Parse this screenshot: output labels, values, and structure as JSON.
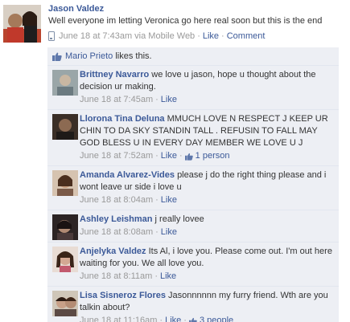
{
  "post": {
    "author": "Jason Valdez",
    "text": "Well everyone im letting Veronica go here real soon but this is the end",
    "timestamp": "June 18 at 7:43am via Mobile Web",
    "like_label": "Like",
    "comment_label": "Comment",
    "separator": "·"
  },
  "likes": {
    "name": "Mario Prieto",
    "suffix": " likes this."
  },
  "comments": [
    {
      "author": "Brittney Navarro",
      "text": "we love u jason, hope u thought about the decision ur making.",
      "timestamp": "June 18 at 7:45am",
      "like_label": "Like",
      "like_count": ""
    },
    {
      "author": "Llorona Tina Deluna",
      "text": "MMUCH LOVE N RESPECT J KEEP UR CHIN TO DA SKY STANDIN TALL . REFUSIN TO FALL MAY GOD BLESS U IN EVERY DAY MEMBER WE LOVE U J",
      "timestamp": "June 18 at 7:52am",
      "like_label": "Like",
      "like_count": "1 person"
    },
    {
      "author": "Amanda Alvarez-Vides",
      "text": "please j do the right thing please and i wont leave ur side i love u",
      "timestamp": "June 18 at 8:04am",
      "like_label": "Like",
      "like_count": ""
    },
    {
      "author": "Ashley Leishman",
      "text": "j really lovee",
      "timestamp": "June 18 at 8:08am",
      "like_label": "Like",
      "like_count": ""
    },
    {
      "author": "Anjelyka Valdez",
      "text": "Its Al, i love you. Please come out. I'm out here waiting for you. We all love you.",
      "timestamp": "June 18 at 8:11am",
      "like_label": "Like",
      "like_count": ""
    },
    {
      "author": "Lisa Sisneroz Flores",
      "text": "Jasonnnnnn my furry friend. Wth are you talkin about?",
      "timestamp": "June 18 at 11:16am",
      "like_label": "Like",
      "like_count": "3 people"
    }
  ],
  "colors": {
    "link": "#3b5998",
    "meta": "#999999",
    "feedback_bg": "#edeff4"
  },
  "icons": {
    "mobile": "mobile-phone-icon",
    "like": "thumbs-up-icon"
  }
}
